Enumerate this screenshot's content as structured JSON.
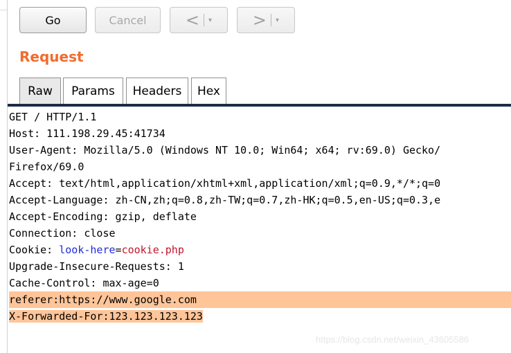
{
  "toolbar": {
    "go_label": "Go",
    "cancel_label": "Cancel",
    "back_arrow": "<",
    "forward_arrow": ">",
    "dropdown_glyph": "▾"
  },
  "request": {
    "title": "Request",
    "tabs": [
      "Raw",
      "Params",
      "Headers",
      "Hex"
    ],
    "active_tab": "Raw",
    "lines": [
      "GET / HTTP/1.1",
      "Host: 111.198.29.45:41734",
      "User-Agent: Mozilla/5.0 (Windows NT 10.0; Win64; x64; rv:69.0) Gecko/",
      "Firefox/69.0",
      "Accept: text/html,application/xhtml+xml,application/xml;q=0.9,*/*;q=0",
      "Accept-Language: zh-CN,zh;q=0.8,zh-TW;q=0.7,zh-HK;q=0.5,en-US;q=0.3,e",
      "Accept-Encoding: gzip, deflate",
      "Connection: close"
    ],
    "cookie": {
      "prefix": "Cookie: ",
      "name": "look-here",
      "eq": "=",
      "value": "cookie.php"
    },
    "lines_after": [
      "Upgrade-Insecure-Requests: 1",
      "Cache-Control: max-age=0"
    ],
    "highlighted_lines": [
      "referer:https://www.google.com",
      "X-Forwarded-For:123.123.123.123"
    ]
  },
  "watermark": "https://blog.csdn.net/weixin_43605586",
  "colors": {
    "title": "#f26b2d",
    "highlight": "#ffc599",
    "cookie_name": "#1f2bd6",
    "cookie_value": "#c0162b",
    "tab_divider": "#1c2c44"
  }
}
